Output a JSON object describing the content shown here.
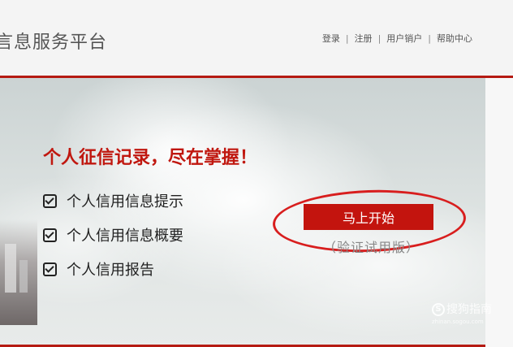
{
  "header": {
    "site_title": "言息服务平台",
    "nav": {
      "login": "登录",
      "register": "注册",
      "cancel_account": "用户销户",
      "help": "帮助中心",
      "separator": "|"
    }
  },
  "hero": {
    "headline": "个人征信记录，尽在掌握！",
    "features": [
      "个人信用信息提示",
      "个人信用信息概要",
      "个人信用报告"
    ],
    "start_button": "马上开始",
    "trial_note": "（验证试用版）"
  },
  "watermark": {
    "brand": "搜狗指南",
    "logo_letter": "S",
    "url": "zhinan.sogou.com"
  },
  "colors": {
    "accent_red": "#c3140e",
    "rule_red": "#b51a12",
    "annotation_circle": "#d81e1e"
  }
}
